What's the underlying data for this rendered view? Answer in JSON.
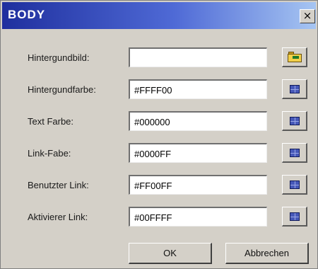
{
  "dialog": {
    "title": "BODY",
    "close_label": "×"
  },
  "fields": [
    {
      "label": "Hintergundbild:",
      "value": "",
      "button_icon": "folder-open-icon"
    },
    {
      "label": "Hintergundfarbe:",
      "value": "#FFFF00",
      "button_icon": "color-palette-icon"
    },
    {
      "label": "Text Farbe:",
      "value": "#000000",
      "button_icon": "color-palette-icon"
    },
    {
      "label": "Link-Fabe:",
      "value": "#0000FF",
      "button_icon": "color-palette-icon"
    },
    {
      "label": "Benutzter Link:",
      "value": "#FF00FF",
      "button_icon": "color-palette-icon"
    },
    {
      "label": "Aktivierer Link:",
      "value": "#00FFFF",
      "button_icon": "color-palette-icon"
    }
  ],
  "buttons": {
    "ok_label": "OK",
    "cancel_label": "Abbrechen"
  }
}
